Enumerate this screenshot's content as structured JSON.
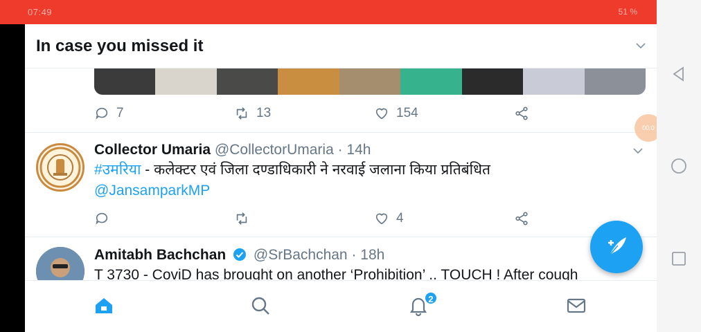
{
  "status_bar": {
    "time_text": "07:49",
    "right_text": "51 %",
    "color": "#ef3b2c"
  },
  "header": {
    "title": "In case you missed it"
  },
  "tweet_prev": {
    "reply_count": "7",
    "retweet_count": "13",
    "like_count": "154"
  },
  "tweets": [
    {
      "name": "Collector Umaria",
      "handle": "@CollectorUmaria",
      "time": "· 14h",
      "hashtag": "#उमरिया",
      "text": " - कलेक्टर एवं जिला दण्डाधिकारी ने नरवाई जलाना किया प्रतिबंधित",
      "mention": "@JansamparkMP",
      "reply_count": "",
      "retweet_count": "",
      "like_count": "4"
    },
    {
      "name": "Amitabh Bachchan",
      "handle": "@SrBachchan",
      "time": "· 18h",
      "text": "T 3730 - CoviD has brought on another ‘Prohibition’ .. TOUCH ! After cough",
      "verified": true
    }
  ],
  "bottom_nav": {
    "notifications_badge": "2"
  },
  "colors": {
    "accent": "#1da1f2",
    "muted": "#657786",
    "text": "#14171a"
  }
}
